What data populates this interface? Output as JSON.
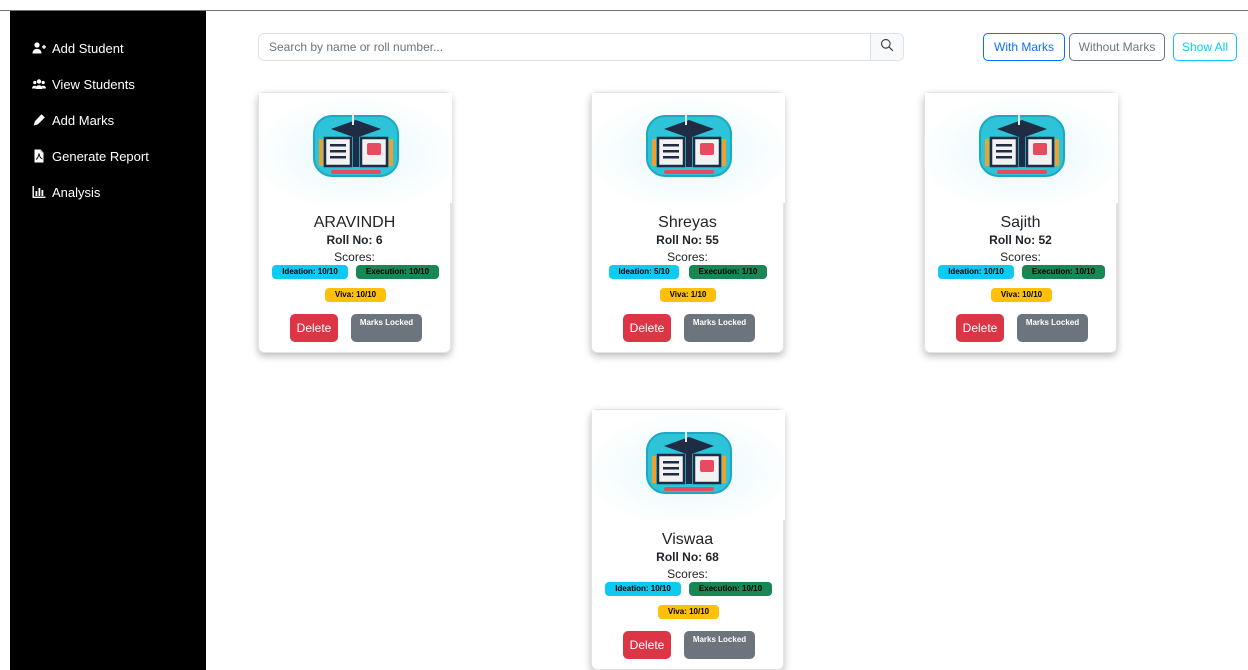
{
  "sidebar": {
    "items": [
      {
        "label": "Add Student",
        "icon": "user-plus-icon"
      },
      {
        "label": "View Students",
        "icon": "users-icon"
      },
      {
        "label": "Add Marks",
        "icon": "pen-icon"
      },
      {
        "label": "Generate Report",
        "icon": "pdf-file-icon"
      },
      {
        "label": "Analysis",
        "icon": "bar-chart-icon"
      }
    ]
  },
  "search": {
    "placeholder": "Search by name or roll number...",
    "value": "",
    "icon": "search-icon"
  },
  "filters": {
    "with_marks": "With Marks",
    "without_marks": "Without Marks",
    "show_all": "Show All"
  },
  "students": [
    {
      "name": "ARAVINDH",
      "roll": "Roll No: 6",
      "scores_label": "Scores:",
      "ideation": "Ideation: 10/10",
      "execution": "Execution: 10/10",
      "viva": "Viva: 10/10",
      "delete": "Delete",
      "locked": "Marks Locked"
    },
    {
      "name": "Shreyas",
      "roll": "Roll No: 55",
      "scores_label": "Scores:",
      "ideation": "Ideation: 5/10",
      "execution": "Execution: 1/10",
      "viva": "Viva: 1/10",
      "delete": "Delete",
      "locked": "Marks Locked"
    },
    {
      "name": "Sajith",
      "roll": "Roll No: 52",
      "scores_label": "Scores:",
      "ideation": "Ideation: 10/10",
      "execution": "Execution: 10/10",
      "viva": "Viva: 10/10",
      "delete": "Delete",
      "locked": "Marks Locked"
    },
    {
      "name": "Viswaa",
      "roll": "Roll No: 68",
      "scores_label": "Scores:",
      "ideation": "Ideation: 10/10",
      "execution": "Execution: 10/10",
      "viva": "Viva: 10/10",
      "delete": "Delete",
      "locked": "Marks Locked"
    }
  ],
  "colors": {
    "primary": "#0d6efd",
    "danger": "#dc3545",
    "secondary": "#6c757d",
    "info": "#0dcaf0",
    "success": "#198754",
    "warning": "#ffc107"
  }
}
